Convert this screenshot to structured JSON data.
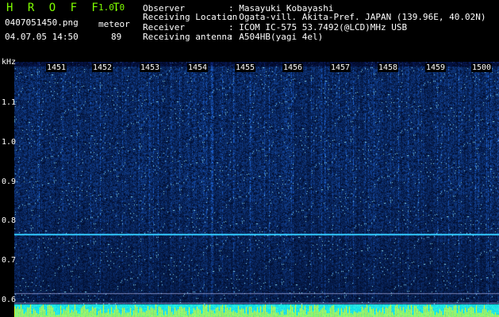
{
  "header": {
    "app_title": "H R O F F T",
    "version": "1.0.0",
    "filename": "0407051450.png",
    "mode": "meteor",
    "datetime": "04.07.05 14:50",
    "count": "89"
  },
  "meta": [
    {
      "key": "Observer",
      "value": ": Masayuki Kobayashi"
    },
    {
      "key": "Receiving Location",
      "value": ": Ogata-vill. Akita-Pref. JAPAN (139.96E, 40.02N)"
    },
    {
      "key": "Receiver",
      "value": ": ICOM IC-575 53.7492(@LCD)MHz USB"
    },
    {
      "key": "Receiving antenna",
      "value": ": A504HB(yagi 4el)"
    }
  ],
  "yaxis": {
    "unit": "kHz",
    "ticks": [
      "1.1",
      "1.0",
      "0.9",
      "0.8",
      "0.7",
      "0.6"
    ]
  },
  "xaxis": {
    "ticks": [
      "1451",
      "1452",
      "1453",
      "1454",
      "1455",
      "1456",
      "1457",
      "1458",
      "1459",
      "1500"
    ]
  },
  "colors": {
    "background": "#000000",
    "header_green": "#7fff00",
    "spectrum_dark": "#000a5a",
    "spectrum_light": "#3c78ff",
    "carrier_line": "#33ccff",
    "bottom_band": "#00ffff",
    "bottom_peaks": "#ffff00"
  }
}
